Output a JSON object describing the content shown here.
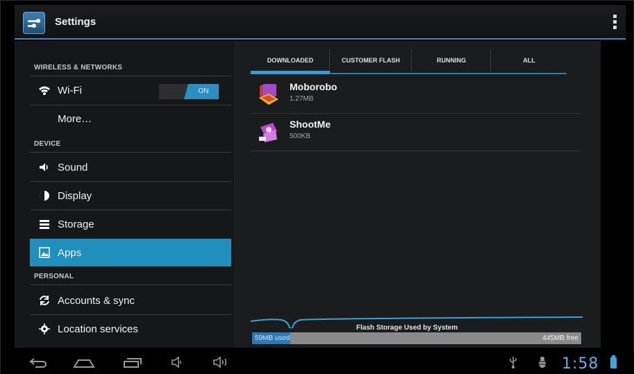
{
  "actionbar": {
    "title": "Settings",
    "icon": "settings-app-icon",
    "overflow_icon": "overflow-menu-icon"
  },
  "settings_list": {
    "sections": [
      {
        "header": "WIRELESS & NETWORKS"
      },
      {
        "header": "DEVICE"
      },
      {
        "header": "PERSONAL"
      }
    ],
    "items": {
      "wifi": {
        "label": "Wi-Fi",
        "icon": "wifi-icon",
        "toggle": "ON"
      },
      "more": {
        "label": "More…"
      },
      "sound": {
        "label": "Sound",
        "icon": "speaker-icon"
      },
      "display": {
        "label": "Display",
        "icon": "brightness-icon"
      },
      "storage": {
        "label": "Storage",
        "icon": "storage-icon"
      },
      "apps": {
        "label": "Apps",
        "icon": "apps-icon",
        "selected": true
      },
      "accounts": {
        "label": "Accounts & sync",
        "icon": "sync-icon"
      },
      "location": {
        "label": "Location services",
        "icon": "location-icon"
      }
    }
  },
  "tabs": [
    {
      "label": "DOWNLOADED",
      "active": true
    },
    {
      "label": "CUSTOMER FLASH"
    },
    {
      "label": "RUNNING"
    },
    {
      "label": "ALL"
    }
  ],
  "apps": [
    {
      "name": "Moborobo",
      "size": "1.27MB",
      "icon": "moborobo-app-icon"
    },
    {
      "name": "ShootMe",
      "size": "500KB",
      "icon": "shootme-app-icon"
    }
  ],
  "storage": {
    "label": "Flash Storage Used by System",
    "used": "59MB used",
    "free": "445MB free",
    "used_fraction": 0.117
  },
  "navbar": {
    "icons": [
      "back-icon",
      "home-icon",
      "recent-apps-icon",
      "volume-down-icon",
      "volume-up-icon",
      "usb-icon",
      "debug-icon"
    ],
    "clock": "1:58"
  },
  "colors": {
    "accent": "#2b8fc2",
    "selected_row": "#1f8fbd",
    "clock": "#5fb6e6"
  }
}
